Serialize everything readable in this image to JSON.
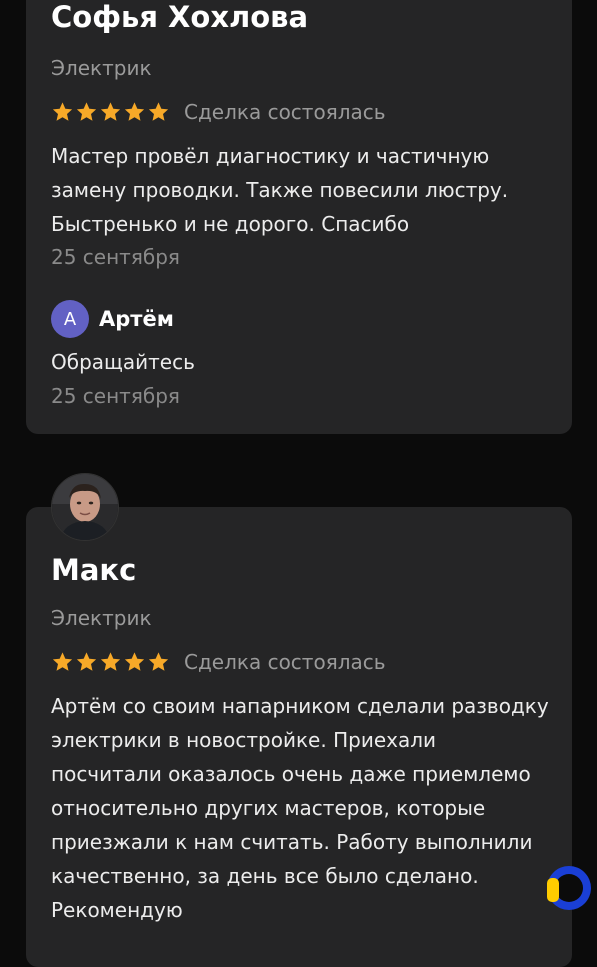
{
  "reviews": [
    {
      "author": "Софья Хохлова",
      "category": "Электрик",
      "rating": 5,
      "rating_max": 5,
      "status": "Сделка состоялась",
      "text": "Мастер провёл диагностику и частичную замену проводки. Также повесили люстру. Быстренько и не дорого. Спасибо",
      "date": "25 сентября",
      "reply": {
        "avatar_letter": "А",
        "author": "Артём",
        "text": "Обращайтесь",
        "date": "25 сентября"
      }
    },
    {
      "author": "Макс",
      "category": "Электрик",
      "rating": 5,
      "rating_max": 5,
      "status": "Сделка состоялась",
      "text": "Артём со своим напарником сделали разводку электрики в новостройке. Приехали посчитали оказалось очень даже приемлемо относительно других мастеров, которые приезжали к нам считать. Работу выполнили качественно, за день все было сделано. Рекомендую"
    }
  ],
  "colors": {
    "background": "#0b0b0b",
    "card": "#252526",
    "star": "#f7a928",
    "reply_avatar": "#6261c4",
    "muted_text": "#9a9a9a"
  },
  "icons": {
    "star": "star-icon",
    "reviewer_photo": "avatar",
    "brand": "brand-logo-icon"
  }
}
